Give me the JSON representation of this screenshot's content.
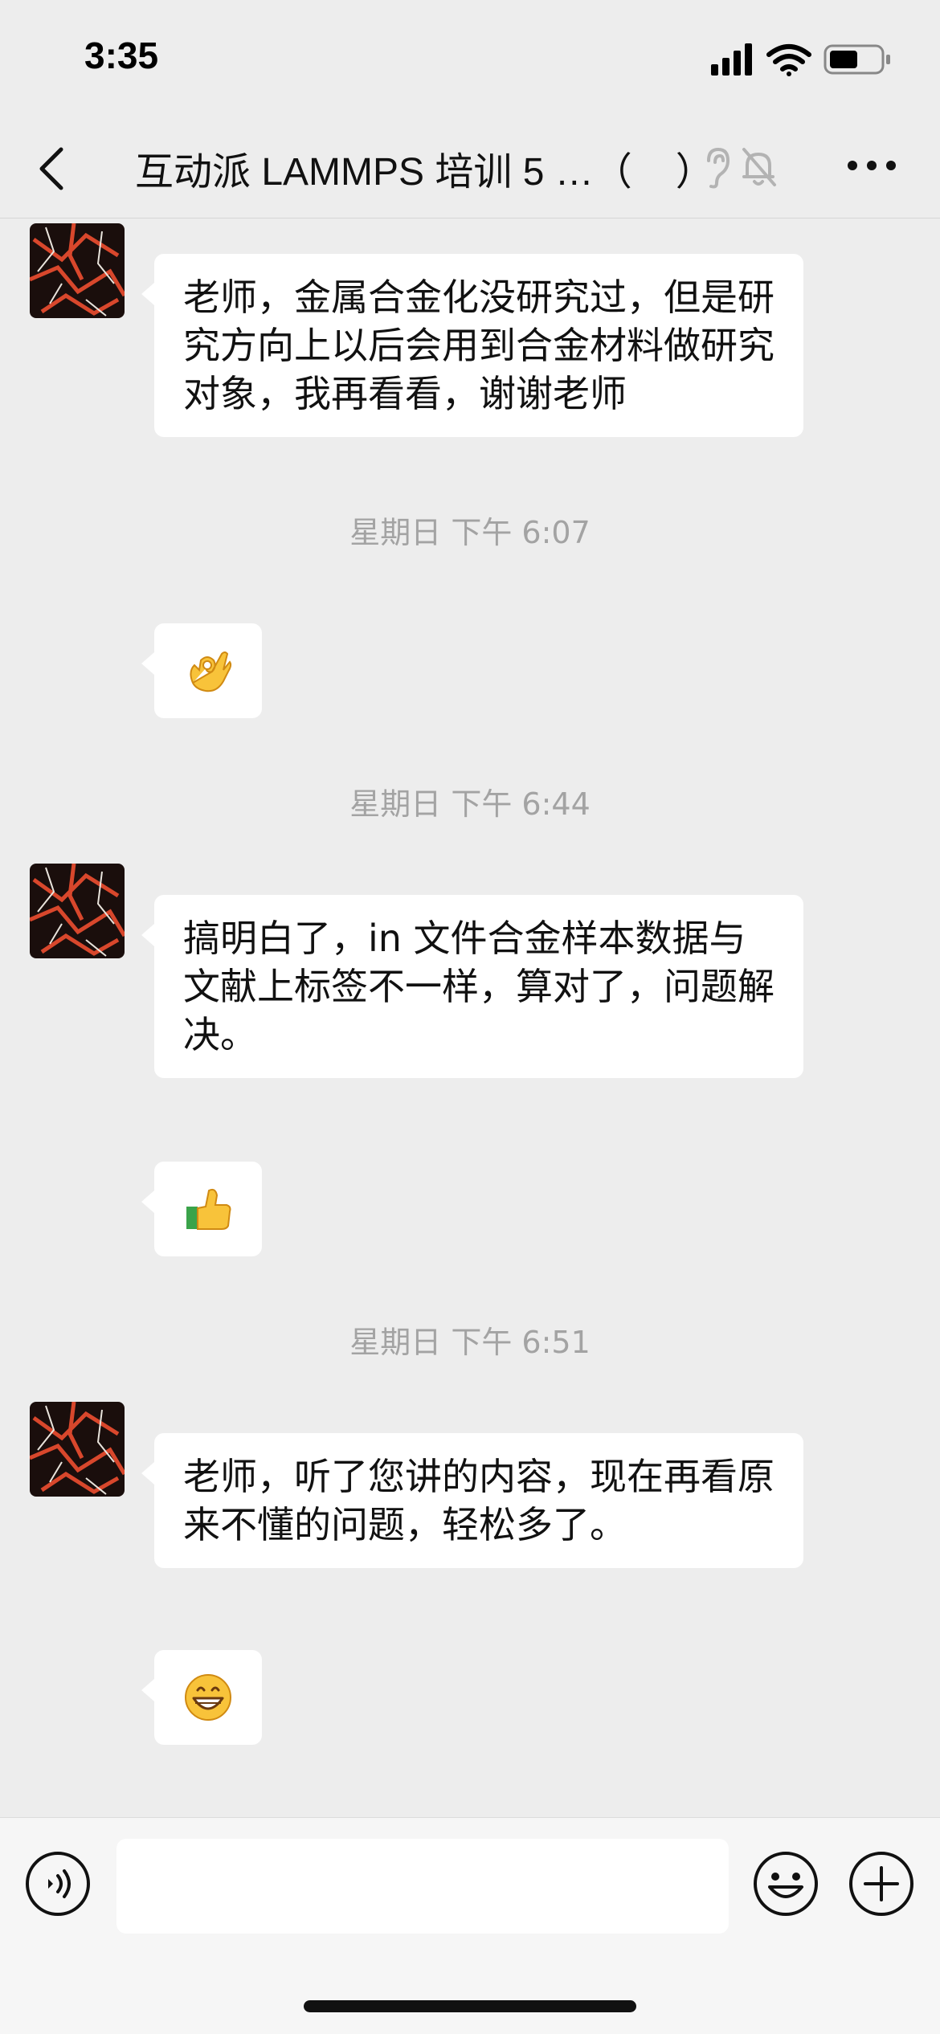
{
  "status_bar": {
    "time": "3:35"
  },
  "nav": {
    "title": "互动派 LAMMPS 培训 5 …（",
    "title_suffix": "）"
  },
  "messages": [
    {
      "type": "text",
      "text": "老师，金属合金化没研究过，但是研究方向上以后会用到合金材料做研究对象，我再看看，谢谢老师"
    },
    {
      "type": "timestamp",
      "text": "星期日 下午 6:07"
    },
    {
      "type": "emoji",
      "icon": "ok-hand-emoji"
    },
    {
      "type": "timestamp",
      "text": "星期日 下午 6:44"
    },
    {
      "type": "text",
      "text": "搞明白了，in 文件合金样本数据与文献上标签不一样，算对了，问题解决。"
    },
    {
      "type": "emoji",
      "icon": "thumbs-up-emoji"
    },
    {
      "type": "timestamp",
      "text": "星期日 下午 6:51"
    },
    {
      "type": "text",
      "text": "老师，听了您讲的内容，现在再看原来不懂的问题，轻松多了。"
    },
    {
      "type": "emoji",
      "icon": "grinning-emoji"
    }
  ],
  "input": {
    "value": "",
    "placeholder": ""
  },
  "colors": {
    "background": "#ededed",
    "bubble": "#ffffff",
    "timestamp": "#a3a3a3"
  }
}
